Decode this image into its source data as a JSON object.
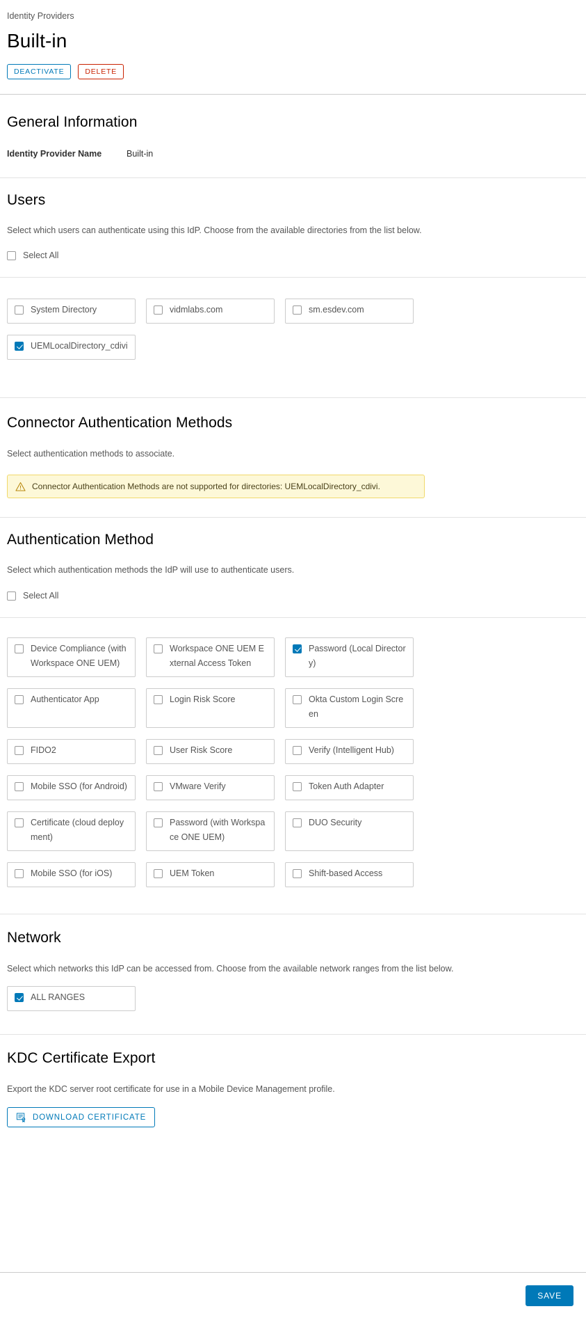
{
  "header": {
    "breadcrumb": "Identity Providers",
    "title": "Built-in",
    "deactivate_label": "DEACTIVATE",
    "delete_label": "DELETE"
  },
  "general_information": {
    "title": "General Information",
    "field_label": "Identity Provider Name",
    "field_value": "Built-in"
  },
  "users": {
    "title": "Users",
    "description": "Select which users can authenticate using this IdP. Choose from the available directories from the list below.",
    "select_all_label": "Select All",
    "select_all_checked": false,
    "directories": [
      {
        "label": "System Directory",
        "checked": false
      },
      {
        "label": "vidmlabs.com",
        "checked": false
      },
      {
        "label": "sm.esdev.com",
        "checked": false
      },
      {
        "label": "UEMLocalDirectory_cdivi",
        "checked": true
      }
    ]
  },
  "connector_authentication_methods": {
    "title": "Connector Authentication Methods",
    "description": "Select authentication methods to associate.",
    "warning": "Connector Authentication Methods are not supported for directories: UEMLocalDirectory_cdivi.",
    "warning_icon": "warning-triangle-icon"
  },
  "authentication_method": {
    "title": "Authentication Method",
    "description": "Select which authentication methods the IdP will use to authenticate users.",
    "select_all_label": "Select All",
    "select_all_checked": false,
    "methods": [
      {
        "label": "Device Compliance (with Workspace ONE UEM)",
        "checked": false
      },
      {
        "label": "Workspace ONE UEM External Access Token",
        "checked": false
      },
      {
        "label": "Password (Local Directory)",
        "checked": true
      },
      {
        "label": "Authenticator App",
        "checked": false
      },
      {
        "label": "Login Risk Score",
        "checked": false
      },
      {
        "label": "Okta Custom Login Screen",
        "checked": false
      },
      {
        "label": "FIDO2",
        "checked": false
      },
      {
        "label": "User Risk Score",
        "checked": false
      },
      {
        "label": "Verify (Intelligent Hub)",
        "checked": false
      },
      {
        "label": "Mobile SSO (for Android)",
        "checked": false
      },
      {
        "label": "VMware Verify",
        "checked": false
      },
      {
        "label": "Token Auth Adapter",
        "checked": false
      },
      {
        "label": "Certificate (cloud deployment)",
        "checked": false
      },
      {
        "label": "Password (with Workspace ONE UEM)",
        "checked": false
      },
      {
        "label": "DUO Security",
        "checked": false
      },
      {
        "label": "Mobile SSO (for iOS)",
        "checked": false
      },
      {
        "label": "UEM Token",
        "checked": false
      },
      {
        "label": "Shift-based Access",
        "checked": false
      }
    ]
  },
  "network": {
    "title": "Network",
    "description": "Select which networks this IdP can be accessed from. Choose from the available network ranges from the list below.",
    "ranges": [
      {
        "label": "ALL RANGES",
        "checked": true
      }
    ]
  },
  "kdc_certificate_export": {
    "title": "KDC Certificate Export",
    "description": "Export the KDC server root certificate for use in a Mobile Device Management profile.",
    "download_label": "DOWNLOAD CERTIFICATE",
    "download_icon": "certificate-icon"
  },
  "footer": {
    "save_label": "SAVE"
  },
  "colors": {
    "accent": "#0079b8",
    "danger": "#c92100",
    "warning_bg": "#fdf8d8",
    "warning_border": "#f1d96b"
  }
}
